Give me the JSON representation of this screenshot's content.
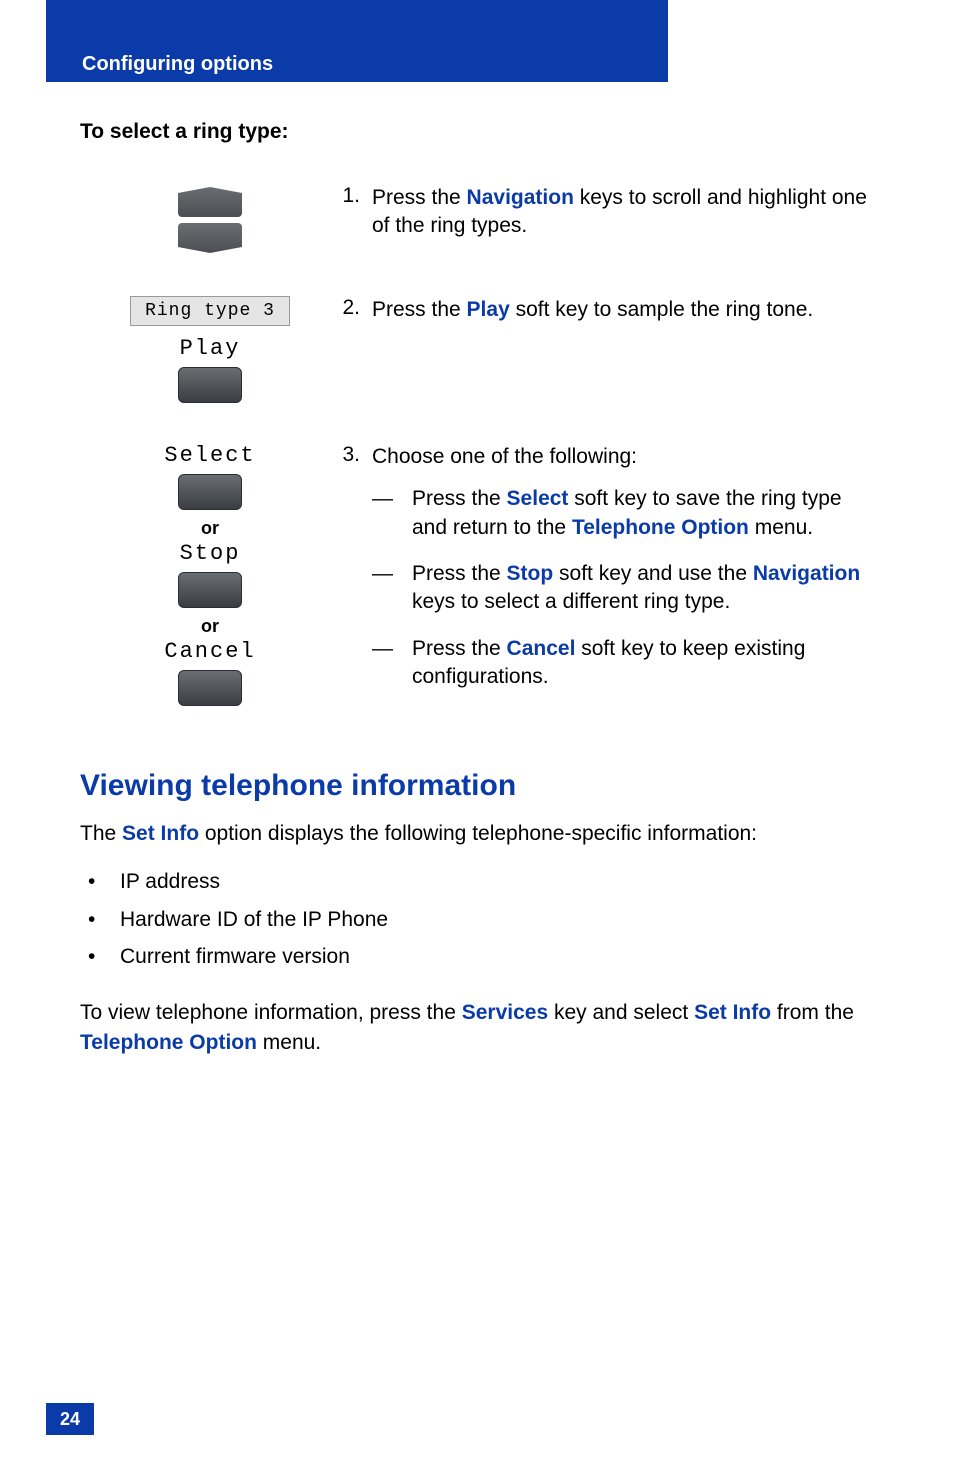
{
  "header": {
    "section_title": "Configuring options"
  },
  "subhead": "To select a ring type:",
  "steps": {
    "s1": {
      "num": "1.",
      "text_pre": "Press the ",
      "emph1": "Navigation",
      "text_post": " keys to scroll and highlight one of the ring types."
    },
    "s2": {
      "num": "2.",
      "lcd_text": "Ring type 3",
      "softkey_label": "Play",
      "text_pre": "Press the ",
      "emph1": "Play",
      "text_post": " soft key to sample the ring tone."
    },
    "s3": {
      "num": "3.",
      "softkey1": "Select",
      "or1": "or",
      "softkey2": "Stop",
      "or2": "or",
      "softkey3": "Cancel",
      "intro": "Choose one of the following:",
      "opt1_pre": "Press the ",
      "opt1_e1": "Select",
      "opt1_mid": " soft key to save the ring type and return to the ",
      "opt1_e2": "Telephone Option",
      "opt1_post": " menu.",
      "opt2_pre": "Press the ",
      "opt2_e1": "Stop",
      "opt2_mid": " soft key and use the ",
      "opt2_e2": "Navigation",
      "opt2_post": " keys to select a different ring type.",
      "opt3_pre": "Press the ",
      "opt3_e1": "Cancel",
      "opt3_post": " soft key to keep existing configurations."
    }
  },
  "section2": {
    "title": "Viewing telephone information",
    "intro_pre": "The ",
    "intro_e1": "Set Info",
    "intro_post": " option displays the following telephone-specific information:",
    "bullets": {
      "b1": "IP address",
      "b2": "Hardware ID of the IP Phone",
      "b3": "Current firmware version"
    },
    "outro_pre": "To view telephone information, press the ",
    "outro_e1": "Services",
    "outro_mid1": " key and select ",
    "outro_e2": "Set Info",
    "outro_mid2": " from the ",
    "outro_e3": "Telephone Option",
    "outro_post": " menu."
  },
  "page_number": "24"
}
